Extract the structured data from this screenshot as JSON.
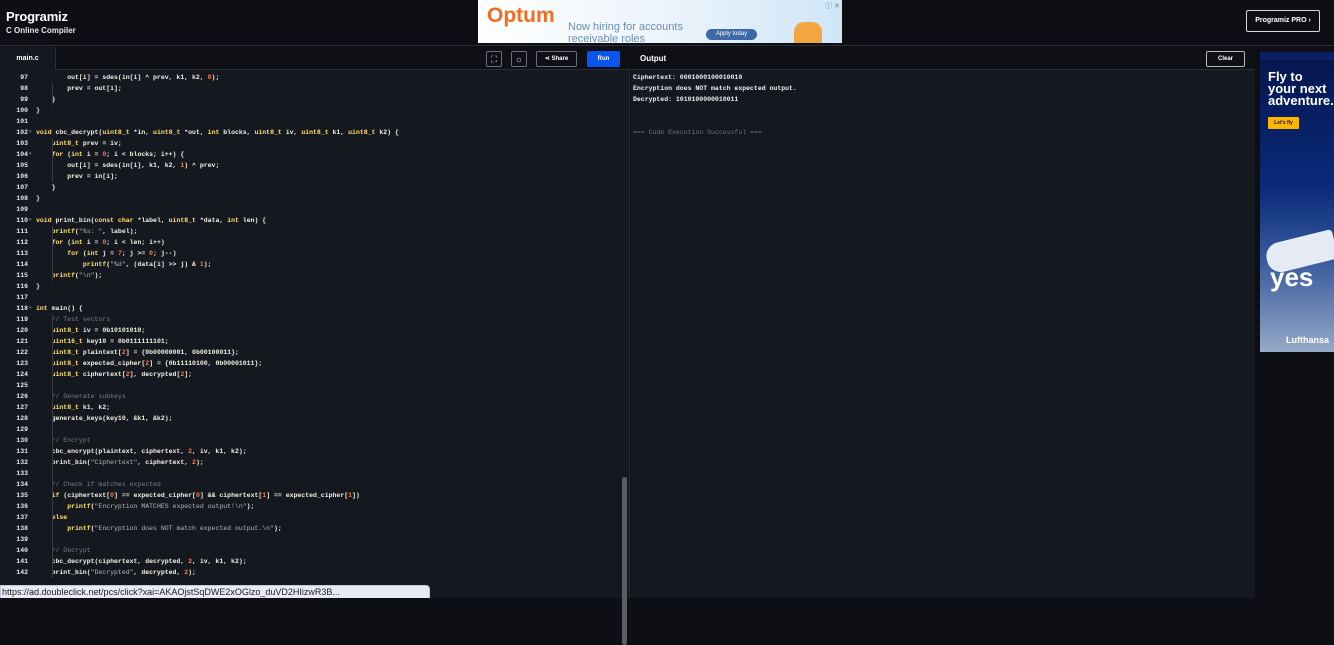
{
  "header": {
    "logo_name": "Programiz",
    "logo_sub": "C Online Compiler",
    "pro_button": "Programiz PRO ›"
  },
  "ad_top": {
    "brand": "Optum",
    "line": "Now hiring for accounts receivable roles",
    "cta": "Apply today",
    "adchoice": "ⓘ ✕"
  },
  "editor": {
    "file_tab": "main.c",
    "share_label": "Share",
    "run_label": "Run",
    "lines": [
      {
        "n": "97",
        "fold": "",
        "parts": [
          [
            "p",
            "        out[i] = sdes(in[i] ^ prev, k1, k2, "
          ],
          [
            "num",
            "0"
          ],
          [
            "p",
            ");"
          ]
        ]
      },
      {
        "n": "98",
        "fold": "",
        "parts": [
          [
            "p",
            "        prev = out[i];"
          ]
        ]
      },
      {
        "n": "99",
        "fold": "",
        "parts": [
          [
            "p",
            "    }"
          ]
        ]
      },
      {
        "n": "100",
        "fold": "",
        "parts": [
          [
            "p",
            "}"
          ]
        ]
      },
      {
        "n": "101",
        "fold": "",
        "parts": []
      },
      {
        "n": "102",
        "fold": "▾",
        "parts": [
          [
            "kw",
            "void"
          ],
          [
            "p",
            " cbc_decrypt("
          ],
          [
            "kw",
            "uint8_t"
          ],
          [
            "p",
            " *in, "
          ],
          [
            "kw",
            "uint8_t"
          ],
          [
            "p",
            " *out, "
          ],
          [
            "kw",
            "int"
          ],
          [
            "p",
            " blocks, "
          ],
          [
            "kw",
            "uint8_t"
          ],
          [
            "p",
            " iv, "
          ],
          [
            "kw",
            "uint8_t"
          ],
          [
            "p",
            " k1, "
          ],
          [
            "kw",
            "uint8_t"
          ],
          [
            "p",
            " k2) {"
          ]
        ]
      },
      {
        "n": "103",
        "fold": "",
        "parts": [
          [
            "p",
            "    "
          ],
          [
            "kw",
            "uint8_t"
          ],
          [
            "p",
            " prev = iv;"
          ]
        ]
      },
      {
        "n": "104",
        "fold": "▾",
        "parts": [
          [
            "p",
            "    "
          ],
          [
            "kw",
            "for"
          ],
          [
            "p",
            " ("
          ],
          [
            "kw",
            "int"
          ],
          [
            "p",
            " i = "
          ],
          [
            "num",
            "0"
          ],
          [
            "p",
            "; i < blocks; i++) {"
          ]
        ]
      },
      {
        "n": "105",
        "fold": "",
        "parts": [
          [
            "p",
            "        out[i] = sdes(in[i], k1, k2, "
          ],
          [
            "num",
            "1"
          ],
          [
            "p",
            ") ^ prev;"
          ]
        ]
      },
      {
        "n": "106",
        "fold": "",
        "parts": [
          [
            "p",
            "        prev = in[i];"
          ]
        ]
      },
      {
        "n": "107",
        "fold": "",
        "parts": [
          [
            "p",
            "    }"
          ]
        ]
      },
      {
        "n": "108",
        "fold": "",
        "parts": [
          [
            "p",
            "}"
          ]
        ]
      },
      {
        "n": "109",
        "fold": "",
        "parts": []
      },
      {
        "n": "110",
        "fold": "▾",
        "parts": [
          [
            "kw",
            "void"
          ],
          [
            "p",
            " print_bin("
          ],
          [
            "kw",
            "const char"
          ],
          [
            "p",
            " *label, "
          ],
          [
            "kw",
            "uint8_t"
          ],
          [
            "p",
            " *data, "
          ],
          [
            "kw",
            "int"
          ],
          [
            "p",
            " len) {"
          ]
        ]
      },
      {
        "n": "111",
        "fold": "",
        "parts": [
          [
            "p",
            "    "
          ],
          [
            "kw",
            "printf"
          ],
          [
            "p",
            "("
          ],
          [
            "str",
            "\"%s: \""
          ],
          [
            "p",
            ", label);"
          ]
        ]
      },
      {
        "n": "112",
        "fold": "",
        "parts": [
          [
            "p",
            "    "
          ],
          [
            "kw",
            "for"
          ],
          [
            "p",
            " ("
          ],
          [
            "kw",
            "int"
          ],
          [
            "p",
            " i = "
          ],
          [
            "num",
            "0"
          ],
          [
            "p",
            "; i < len; i++)"
          ]
        ]
      },
      {
        "n": "113",
        "fold": "",
        "parts": [
          [
            "p",
            "        "
          ],
          [
            "kw",
            "for"
          ],
          [
            "p",
            " ("
          ],
          [
            "kw",
            "int"
          ],
          [
            "p",
            " j = "
          ],
          [
            "num",
            "7"
          ],
          [
            "p",
            "; j >= "
          ],
          [
            "num",
            "0"
          ],
          [
            "p",
            "; j--)"
          ]
        ]
      },
      {
        "n": "114",
        "fold": "",
        "parts": [
          [
            "p",
            "            "
          ],
          [
            "kw",
            "printf"
          ],
          [
            "p",
            "("
          ],
          [
            "str",
            "\"%d\""
          ],
          [
            "p",
            ", (data[i] >> j) & "
          ],
          [
            "num",
            "1"
          ],
          [
            "p",
            ");"
          ]
        ]
      },
      {
        "n": "115",
        "fold": "",
        "parts": [
          [
            "p",
            "    "
          ],
          [
            "kw",
            "printf"
          ],
          [
            "p",
            "("
          ],
          [
            "str",
            "\"\\n\""
          ],
          [
            "p",
            ");"
          ]
        ]
      },
      {
        "n": "116",
        "fold": "",
        "parts": [
          [
            "p",
            "}"
          ]
        ]
      },
      {
        "n": "117",
        "fold": "",
        "parts": []
      },
      {
        "n": "118",
        "fold": "▾",
        "parts": [
          [
            "kw",
            "int"
          ],
          [
            "p",
            " main() {"
          ]
        ]
      },
      {
        "n": "119",
        "fold": "",
        "parts": [
          [
            "p",
            "    "
          ],
          [
            "com",
            "// Test vectors"
          ]
        ]
      },
      {
        "n": "120",
        "fold": "",
        "parts": [
          [
            "p",
            "    "
          ],
          [
            "kw",
            "uint8_t"
          ],
          [
            "p",
            " iv = 0b10101010;"
          ]
        ]
      },
      {
        "n": "121",
        "fold": "",
        "parts": [
          [
            "p",
            "    "
          ],
          [
            "kw",
            "uint16_t"
          ],
          [
            "p",
            " key10 = 0b0111111101;"
          ]
        ]
      },
      {
        "n": "122",
        "fold": "",
        "parts": [
          [
            "p",
            "    "
          ],
          [
            "kw",
            "uint8_t"
          ],
          [
            "p",
            " plaintext["
          ],
          [
            "num",
            "2"
          ],
          [
            "p",
            "] = {0b00000001, 0b00100011};"
          ]
        ]
      },
      {
        "n": "123",
        "fold": "",
        "parts": [
          [
            "p",
            "    "
          ],
          [
            "kw",
            "uint8_t"
          ],
          [
            "p",
            " expected_cipher["
          ],
          [
            "num",
            "2"
          ],
          [
            "p",
            "] = {0b11110100, 0b00001011};"
          ]
        ]
      },
      {
        "n": "124",
        "fold": "",
        "parts": [
          [
            "p",
            "    "
          ],
          [
            "kw",
            "uint8_t"
          ],
          [
            "p",
            " ciphertext["
          ],
          [
            "num",
            "2"
          ],
          [
            "p",
            "], decrypted["
          ],
          [
            "num",
            "2"
          ],
          [
            "p",
            "];"
          ]
        ]
      },
      {
        "n": "125",
        "fold": "",
        "parts": []
      },
      {
        "n": "126",
        "fold": "",
        "parts": [
          [
            "p",
            "    "
          ],
          [
            "com",
            "// Generate subkeys"
          ]
        ]
      },
      {
        "n": "127",
        "fold": "",
        "parts": [
          [
            "p",
            "    "
          ],
          [
            "kw",
            "uint8_t"
          ],
          [
            "p",
            " k1, k2;"
          ]
        ]
      },
      {
        "n": "128",
        "fold": "",
        "parts": [
          [
            "p",
            "    generate_keys(key10, &k1, &k2);"
          ]
        ]
      },
      {
        "n": "129",
        "fold": "",
        "parts": []
      },
      {
        "n": "130",
        "fold": "",
        "parts": [
          [
            "p",
            "    "
          ],
          [
            "com",
            "// Encrypt"
          ]
        ]
      },
      {
        "n": "131",
        "fold": "",
        "parts": [
          [
            "p",
            "    cbc_encrypt(plaintext, ciphertext, "
          ],
          [
            "num",
            "2"
          ],
          [
            "p",
            ", iv, k1, k2);"
          ]
        ]
      },
      {
        "n": "132",
        "fold": "",
        "parts": [
          [
            "p",
            "    print_bin("
          ],
          [
            "str",
            "\"Ciphertext\""
          ],
          [
            "p",
            ", ciphertext, "
          ],
          [
            "num",
            "2"
          ],
          [
            "p",
            ");"
          ]
        ]
      },
      {
        "n": "133",
        "fold": "",
        "parts": []
      },
      {
        "n": "134",
        "fold": "",
        "parts": [
          [
            "p",
            "    "
          ],
          [
            "com",
            "// Check if matches expected"
          ]
        ]
      },
      {
        "n": "135",
        "fold": "",
        "parts": [
          [
            "p",
            "    "
          ],
          [
            "kw",
            "if"
          ],
          [
            "p",
            " (ciphertext["
          ],
          [
            "num",
            "0"
          ],
          [
            "p",
            "] == expected_cipher["
          ],
          [
            "num",
            "0"
          ],
          [
            "p",
            "] && ciphertext["
          ],
          [
            "num",
            "1"
          ],
          [
            "p",
            "] == expected_cipher["
          ],
          [
            "num",
            "1"
          ],
          [
            "p",
            "])"
          ]
        ]
      },
      {
        "n": "136",
        "fold": "",
        "parts": [
          [
            "p",
            "        "
          ],
          [
            "kw",
            "printf"
          ],
          [
            "p",
            "("
          ],
          [
            "str",
            "\"Encryption MATCHES expected output!\\n\""
          ],
          [
            "p",
            ");"
          ]
        ]
      },
      {
        "n": "137",
        "fold": "",
        "parts": [
          [
            "p",
            "    "
          ],
          [
            "kw",
            "else"
          ]
        ]
      },
      {
        "n": "138",
        "fold": "",
        "parts": [
          [
            "p",
            "        "
          ],
          [
            "kw",
            "printf"
          ],
          [
            "p",
            "("
          ],
          [
            "str",
            "\"Encryption does NOT match expected output.\\n\""
          ],
          [
            "p",
            ");"
          ]
        ]
      },
      {
        "n": "139",
        "fold": "",
        "parts": []
      },
      {
        "n": "140",
        "fold": "",
        "parts": [
          [
            "p",
            "    "
          ],
          [
            "com",
            "// Decrypt"
          ]
        ]
      },
      {
        "n": "141",
        "fold": "",
        "parts": [
          [
            "p",
            "    cbc_decrypt(ciphertext, decrypted, "
          ],
          [
            "num",
            "2"
          ],
          [
            "p",
            ", iv, k1, k2);"
          ]
        ]
      },
      {
        "n": "142",
        "fold": "",
        "parts": [
          [
            "p",
            "    print_bin("
          ],
          [
            "str",
            "\"Decrypted\""
          ],
          [
            "p",
            ", decrypted, "
          ],
          [
            "num",
            "2"
          ],
          [
            "p",
            ");"
          ]
        ]
      }
    ]
  },
  "output": {
    "title": "Output",
    "clear_label": "Clear",
    "lines": [
      {
        "text": "Ciphertext: 0001000100010010",
        "muted": false
      },
      {
        "text": "Encryption does NOT match expected output.",
        "muted": false
      },
      {
        "text": "Decrypted: 1010100000010011",
        "muted": false
      },
      {
        "text": "",
        "muted": false
      },
      {
        "text": "",
        "muted": false
      },
      {
        "text": "=== Code Execution Successful ===",
        "muted": true
      }
    ]
  },
  "ad_side": {
    "headline": "Fly to your next adventure.",
    "cta": "Let's fly",
    "slogan": "yes",
    "brand": "Lufthansa"
  },
  "status_bar": {
    "url": "https://ad.doubleclick.net/pcs/click?xai=AKAOjstSqDWE2xOGlzo_duVD2HIizwR3B..."
  }
}
